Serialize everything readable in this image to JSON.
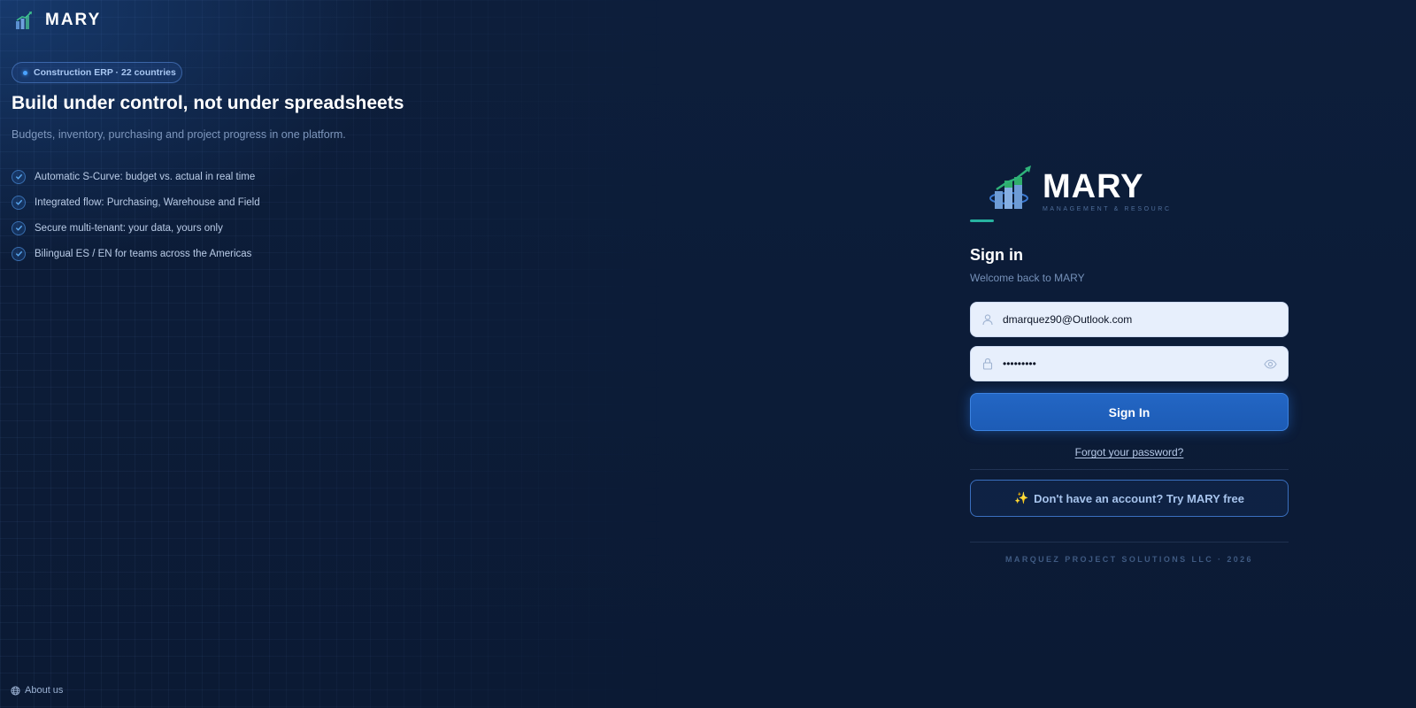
{
  "brand": {
    "name": "MARY",
    "logo_icon": "bar-chart-growth-icon"
  },
  "hero": {
    "pill_text": "Construction ERP · 22 countries",
    "title": "Build under control, not under spreadsheets",
    "subtitle": "Budgets, inventory, purchasing and project progress in one platform.",
    "features": [
      "Automatic S-Curve: budget vs. actual in real time",
      "Integrated flow: Purchasing, Warehouse and Field",
      "Secure multi-tenant: your data, yours only",
      "Bilingual ES / EN for teams across the Americas"
    ]
  },
  "footer_left": {
    "about_label": "About us",
    "icon": "globe-icon"
  },
  "login": {
    "logo_name": "MARY",
    "logo_tagline": "MANAGEMENT & RESOURC",
    "title": "Sign in",
    "subtitle": "Welcome back to MARY",
    "email_value": "dmarquez90@Outlook.com",
    "password_value": "•••••••••",
    "submit_label": "Sign In",
    "forgot_label": "Forgot your password?",
    "trial_icon": "✨",
    "trial_label": "Don't have an account? Try MARY free",
    "footer": "MARQUEZ PROJECT SOLUTIONS LLC · 2026"
  },
  "colors": {
    "background": "#0c1a33",
    "accent_blue": "#1d5cb6",
    "accent_teal": "#27b3a0",
    "input_bg": "#e7effc"
  }
}
